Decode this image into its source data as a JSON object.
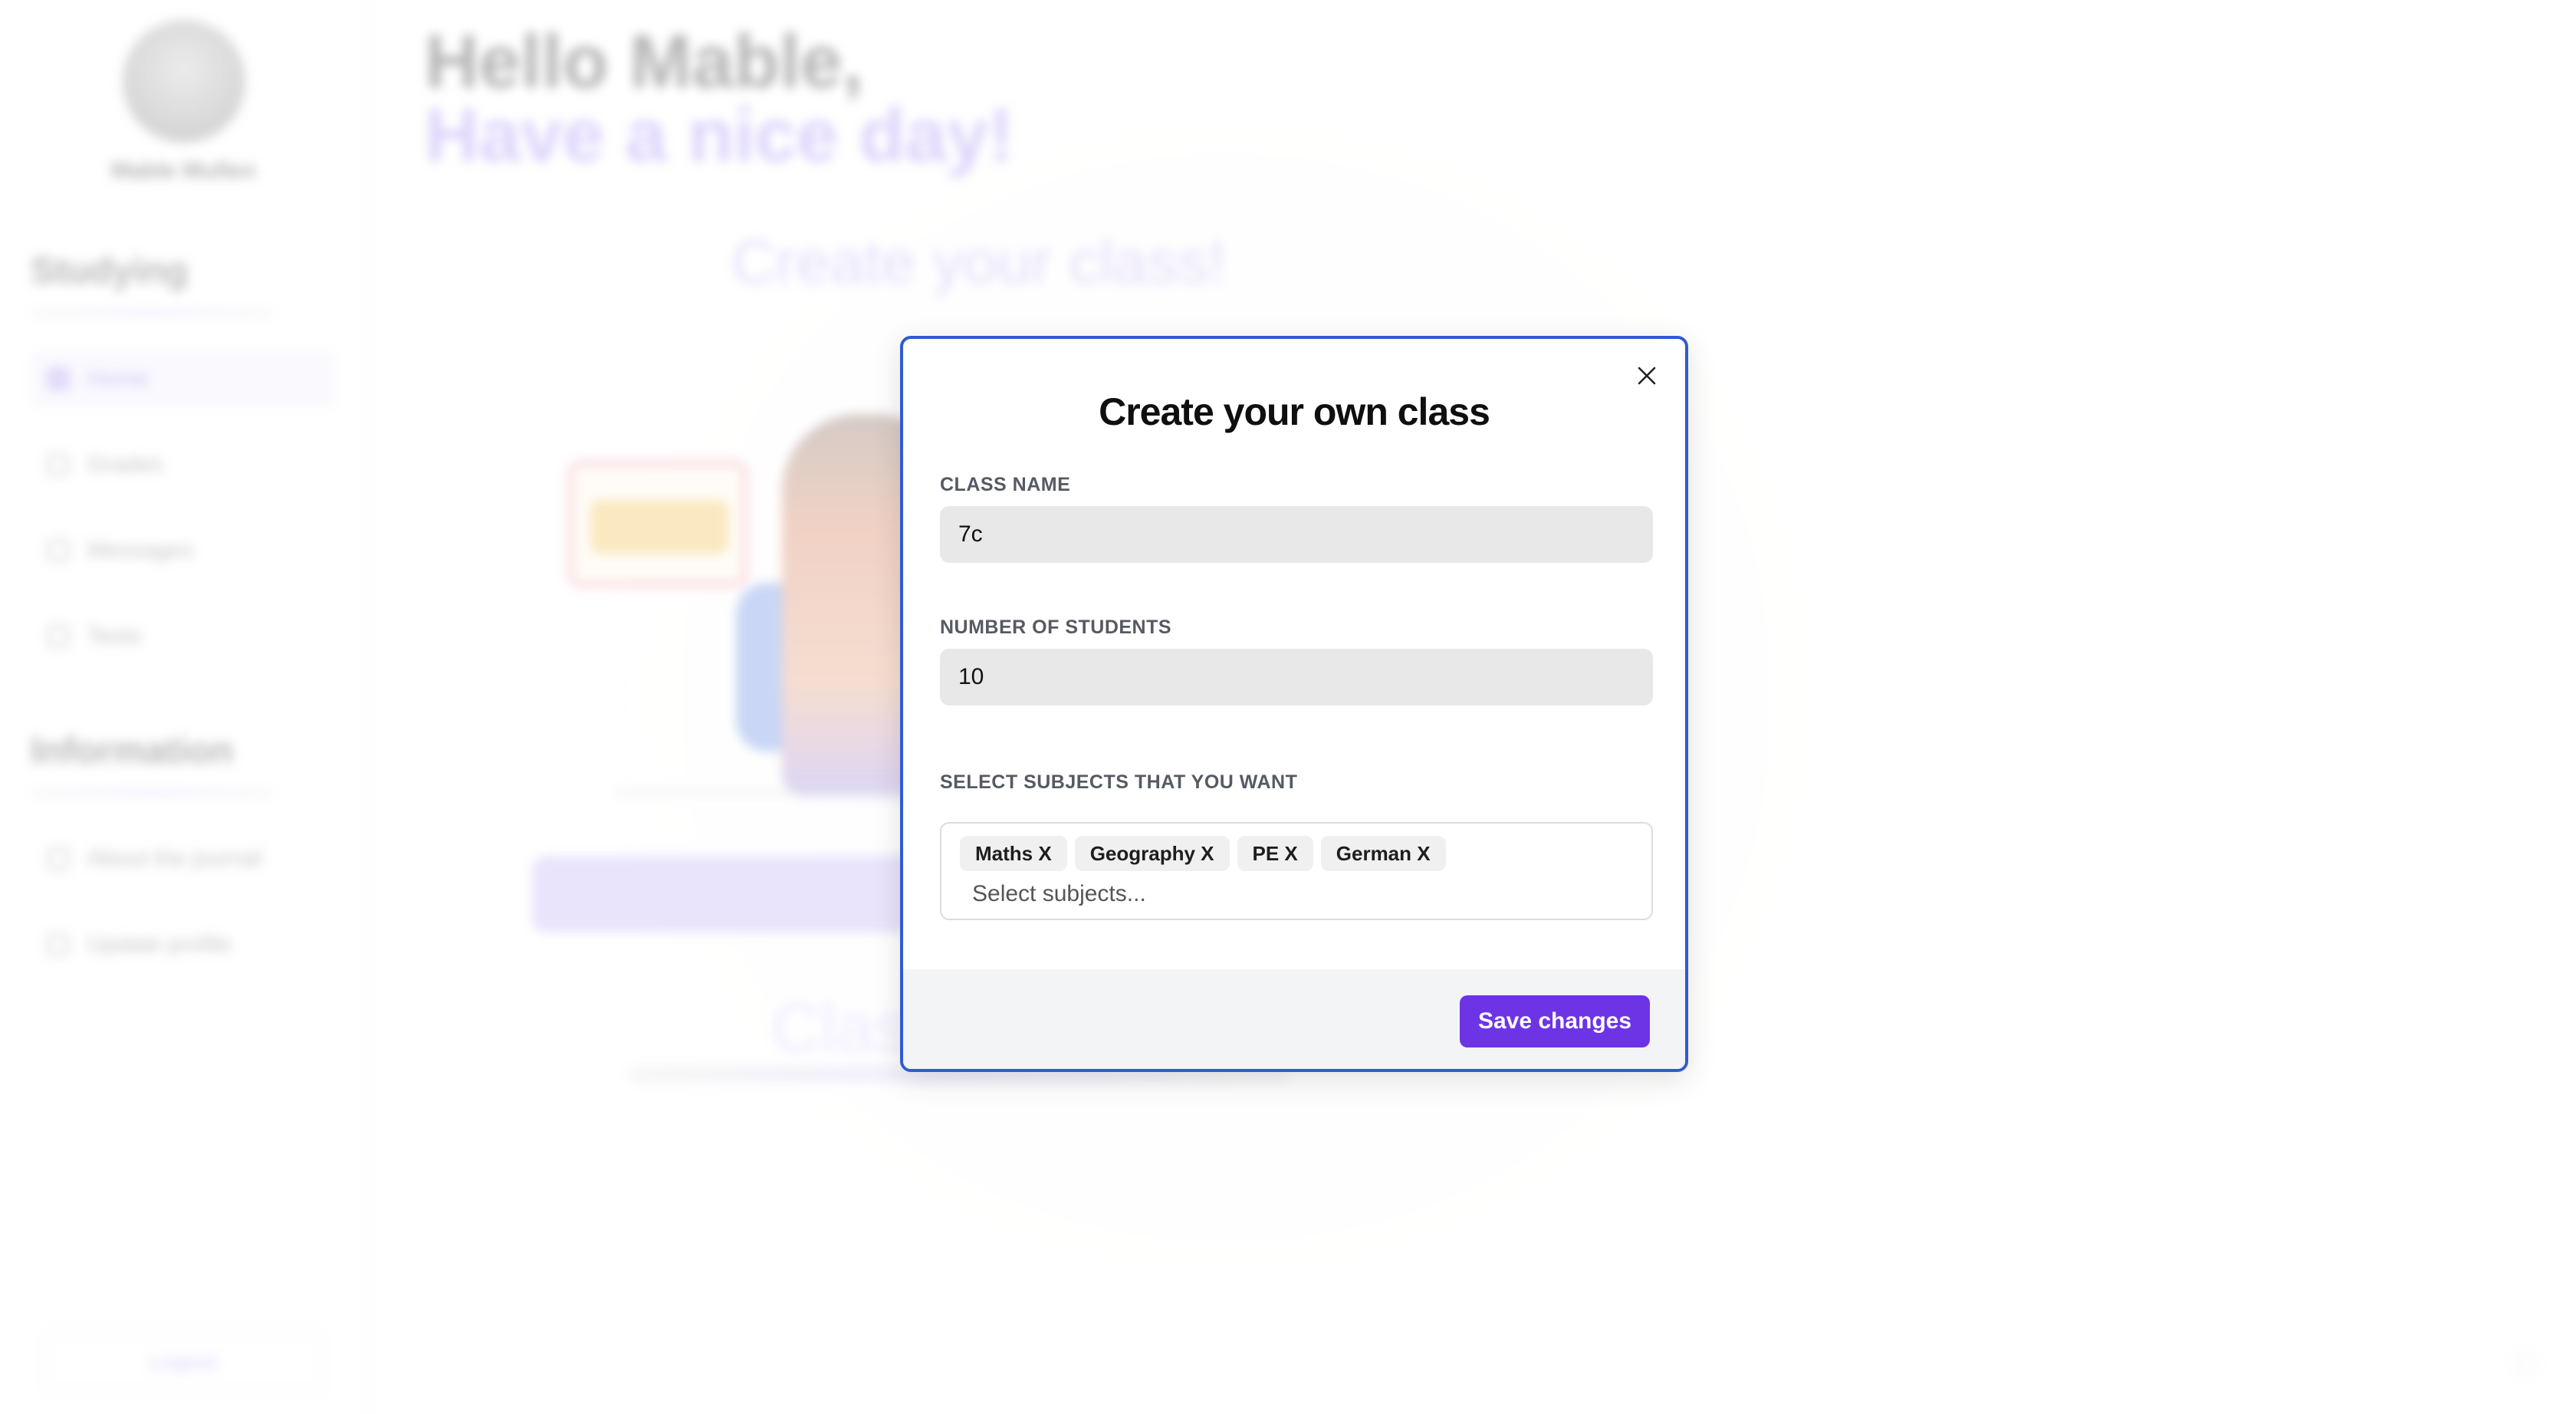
{
  "background": {
    "sidebar": {
      "user_name": "Mable Mullen",
      "sections": [
        {
          "title": "Studying",
          "items": [
            "Home",
            "Grades",
            "Messages",
            "Tests"
          ]
        },
        {
          "title": "Information",
          "items": [
            "About the journal",
            "Update profile"
          ]
        }
      ],
      "logout_label": "Logout"
    },
    "greeting_line1": "Hello Mable,",
    "greeting_line2": "Have a nice day!",
    "create_title": "Create your class!",
    "class_heading": "Class"
  },
  "modal": {
    "title": "Create your own class",
    "class_name": {
      "label": "CLASS NAME",
      "value": "7c"
    },
    "num_students": {
      "label": "NUMBER OF STUDENTS",
      "value": "10"
    },
    "subjects": {
      "label": "SELECT SUBJECTS THAT YOU WANT",
      "selected": [
        "Maths X",
        "Geography X",
        "PE X",
        "German X"
      ],
      "placeholder": "Select subjects..."
    },
    "save_label": "Save changes"
  },
  "colors": {
    "modal_border": "#2f5bd3",
    "primary_button": "#6d34e6",
    "footer_bg": "#f3f4f6",
    "input_bg": "#e8e8e8"
  }
}
